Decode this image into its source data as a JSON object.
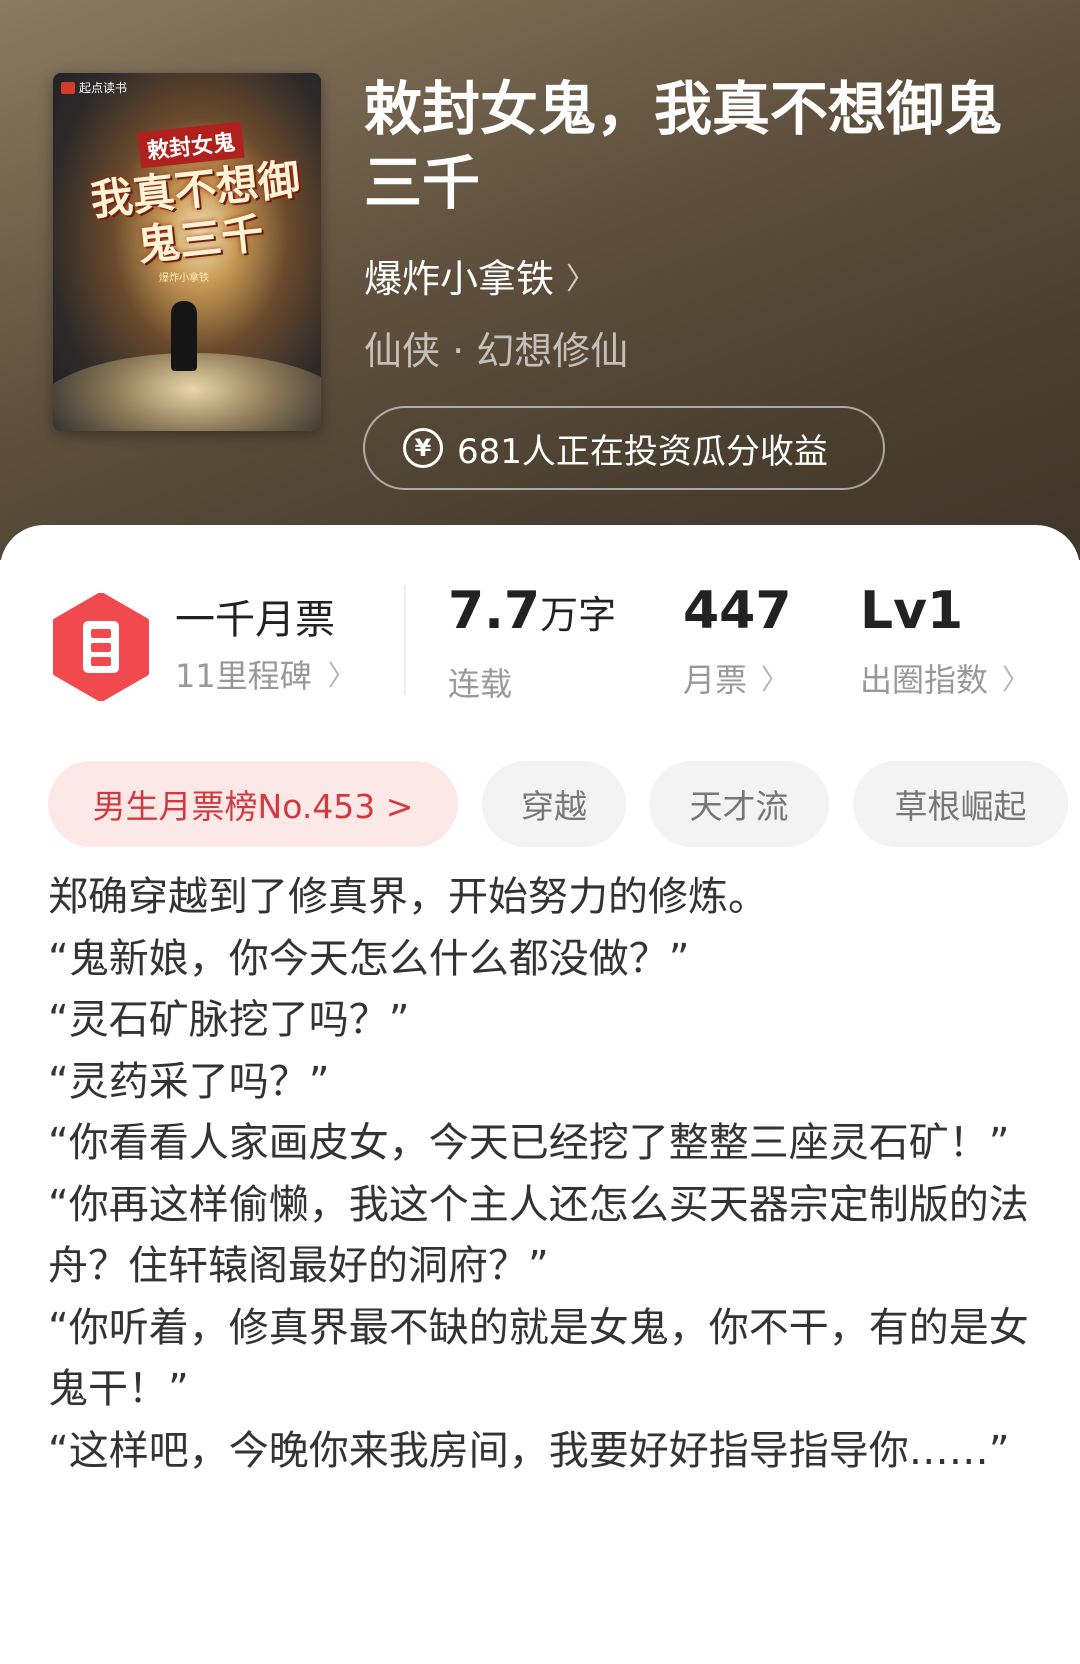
{
  "book": {
    "title": "敕封女鬼，我真不想御鬼三千",
    "author": "爆炸小拿铁",
    "genre": "仙侠 · 幻想修仙",
    "invest_text": "681人正在投资瓜分收益",
    "cover": {
      "brand": "起点读书",
      "small_title": "敕封女鬼",
      "big_title": "我真不想御鬼三千",
      "author_small": "爆炸小拿铁"
    }
  },
  "stats": {
    "milestone": {
      "title": "一千月票",
      "sub": "11里程碑"
    },
    "word_count": {
      "value": "7.7",
      "unit": "万字",
      "label": "连载"
    },
    "monthly_votes": {
      "value": "447",
      "label": "月票"
    },
    "circle_index": {
      "value": "Lv1",
      "label": "出圈指数"
    }
  },
  "tags": [
    {
      "label": "男生月票榜No.453 >"
    },
    {
      "label": "穿越"
    },
    {
      "label": "天才流"
    },
    {
      "label": "草根崛起"
    }
  ],
  "description": [
    "郑确穿越到了修真界，开始努力的修炼。",
    "“鬼新娘，你今天怎么什么都没做？”",
    "“灵石矿脉挖了吗？”",
    "“灵药采了吗？”",
    "“你看看人家画皮女，今天已经挖了整整三座灵石矿！”",
    "“你再这样偷懒，我这个主人还怎么买天器宗定制版的法舟？住轩辕阁最好的洞府？”",
    "“你听着，修真界最不缺的就是女鬼，你不干，有的是女鬼干！”",
    "“这样吧，今晚你来我房间，我要好好指导指导你……”"
  ],
  "icons": {
    "milestone_badge": "milestone-hexagon-icon",
    "invest": "yen-coin-icon",
    "chevron": "chevron-right-icon"
  },
  "colors": {
    "badge_red": "#f04a4f",
    "rank_tag_bg": "#fde8e8",
    "rank_tag_text": "#d23a3f"
  }
}
